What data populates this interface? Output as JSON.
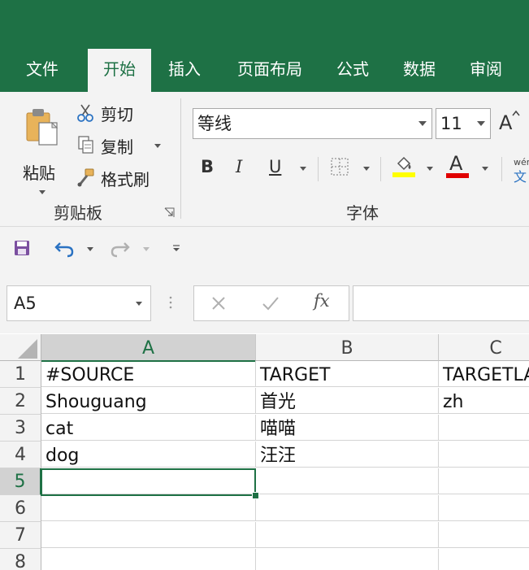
{
  "ribbon": {
    "tabs": [
      {
        "label": "文件",
        "active": false
      },
      {
        "label": "开始",
        "active": true
      },
      {
        "label": "插入",
        "active": false
      },
      {
        "label": "页面布局",
        "active": false
      },
      {
        "label": "公式",
        "active": false
      },
      {
        "label": "数据",
        "active": false
      },
      {
        "label": "审阅",
        "active": false
      }
    ],
    "clipboard": {
      "paste_label": "粘贴",
      "cut_label": "剪切",
      "copy_label": "复制",
      "format_painter_label": "格式刷",
      "group_label": "剪贴板"
    },
    "font": {
      "font_name": "等线",
      "font_size": "11",
      "bold": "B",
      "italic": "I",
      "underline": "U",
      "grow_font": "A",
      "font_color": "A",
      "phonetic_top": "wén",
      "phonetic_bottom": "文",
      "group_label": "字体",
      "fill_color": "#ffff00",
      "text_color": "#e00000"
    }
  },
  "formula_bar": {
    "name_box": "A5",
    "fx_label": "fx",
    "formula": ""
  },
  "grid": {
    "columns": [
      "A",
      "B",
      "C"
    ],
    "selected_column": "A",
    "rows": [
      "1",
      "2",
      "3",
      "4",
      "5",
      "6",
      "7",
      "8"
    ],
    "selected_row": "5",
    "cells": [
      [
        "#SOURCE",
        "TARGET",
        "TARGETLANG"
      ],
      [
        "Shouguang",
        "首光",
        "zh"
      ],
      [
        "cat",
        "喵喵",
        ""
      ],
      [
        "dog",
        "汪汪",
        ""
      ],
      [
        "",
        "",
        ""
      ],
      [
        "",
        "",
        ""
      ],
      [
        "",
        "",
        ""
      ],
      [
        "",
        "",
        ""
      ]
    ]
  },
  "colors": {
    "brand": "#1e7145",
    "ribbon_bg": "#f3f3f3"
  }
}
